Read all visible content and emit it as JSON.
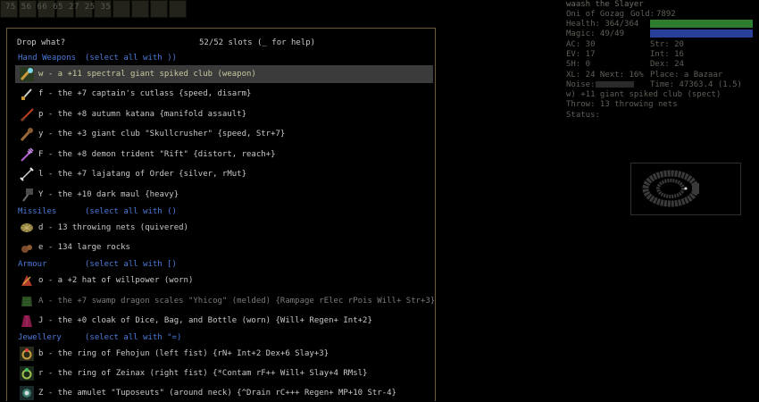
{
  "message_bar": {
    "text": "75 56 66 65 27 25 35"
  },
  "drop_menu": {
    "prompt": "Drop what?",
    "slots": "52/52 slots (_ for help)",
    "categories": {
      "hand_weapons": {
        "label": "Hand Weapons",
        "select": "(select all with ))"
      },
      "missiles": {
        "label": "Missiles",
        "select": "(select all with ()"
      },
      "armour": {
        "label": "Armour",
        "select": "(select all with [)"
      },
      "jewellery": {
        "label": "Jewellery",
        "select": "(select all with \"=)"
      }
    },
    "items": [
      {
        "text": "w - a +11 spectral giant spiked club (weapon)",
        "icon": "spiked-club-icon",
        "color": "#c8c8a0"
      },
      {
        "text": "f - the +7 captain's cutlass {speed, disarm}",
        "icon": "cutlass-icon",
        "color": "#c8c8c8"
      },
      {
        "text": "p - the +8 autumn katana {manifold assault}",
        "icon": "katana-icon",
        "color": "#c8c8c8"
      },
      {
        "text": "y - the +3 giant club \"Skullcrusher\" {speed, Str+7}",
        "icon": "giant-club-icon",
        "color": "#c8c8c8"
      },
      {
        "text": "F - the +8 demon trident \"Rift\" {distort, reach+}",
        "icon": "trident-icon",
        "color": "#c8c8c8"
      },
      {
        "text": "l - the +7 lajatang of Order {silver, rMut}",
        "icon": "lajatang-icon",
        "color": "#c8c8c8"
      },
      {
        "text": "Y - the +10 dark maul {heavy}",
        "icon": "maul-icon",
        "color": "#c8c8c8"
      },
      {
        "text": "d - 13 throwing nets (quivered)",
        "icon": "net-icon",
        "color": "#c8c8c8"
      },
      {
        "text": "e - 134 large rocks",
        "icon": "rock-icon",
        "color": "#c8c8c8"
      },
      {
        "text": "o - a +2 hat of willpower (worn)",
        "icon": "hat-icon",
        "color": "#c8c8c8"
      },
      {
        "text": "A - the +7 swamp dragon scales \"Yhicog\" (melded) {Rampage rElec rPois Will+ Str+3}",
        "icon": "dragon-scales-icon",
        "color": "#7a7a7a"
      },
      {
        "text": "J - the +0 cloak of Dice, Bag, and Bottle (worn) {Will+ Regen+ Int+2}",
        "icon": "cloak-icon",
        "color": "#c8c8c8"
      },
      {
        "text": "b - the ring of Fehojun (left fist) {rN+ Int+2 Dex+6 Slay+3}",
        "icon": "ring-icon",
        "color": "#c8c8c8"
      },
      {
        "text": "r - the ring of Zeinax (right fist) {*Contam rF++ Will+ Slay+4 RMsl}",
        "icon": "ring-icon",
        "color": "#c8c8c8"
      },
      {
        "text": "Z - the amulet \"Tuposeuts\" (around neck) {^Drain rC+++ Regen+ MP+10 Str-4}",
        "icon": "amulet-icon",
        "color": "#c8c8c8"
      }
    ]
  },
  "stats": {
    "name": "waash the Slayer",
    "god": "Oni of Gozag",
    "gold_label": "Gold:",
    "gold": "7892",
    "health": "Health: 364/364",
    "magic": "Magic:  49/49",
    "ac": "AC: 30",
    "ev": "EV: 17",
    "sh": "SH: 0",
    "str": "Str: 20",
    "int": "Int: 16",
    "dex": "Dex: 24",
    "xl": "XL: 24  Next: 16%",
    "place": "Place: a Bazaar",
    "noise_label": "Noise:",
    "time": "Time: 47363.4 (1.5)",
    "wielded": "w) +11 giant spiked club (spect)",
    "quiver": "Throw: 13 throwing nets",
    "status": "Status:",
    "health_fraction": 1.0,
    "magic_fraction": 1.0,
    "colors": {
      "health": "#2e7d2e",
      "magic": "#2a3f9a"
    }
  }
}
